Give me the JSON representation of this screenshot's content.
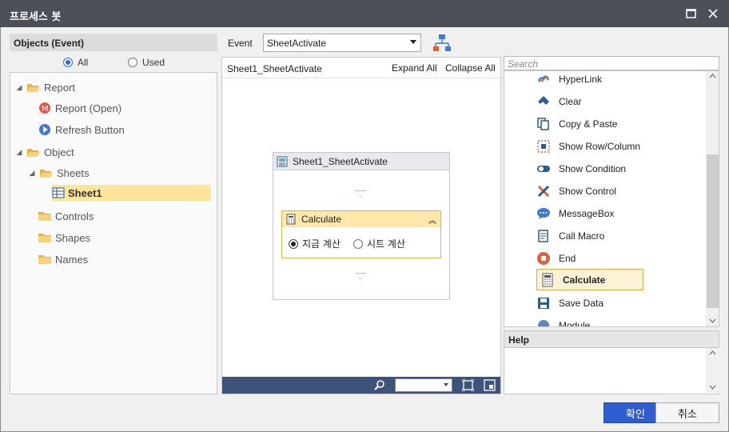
{
  "window": {
    "title": "프로세스 봇"
  },
  "left": {
    "header": "Objects (Event)",
    "filter": {
      "all": "All",
      "used": "Used",
      "selected": "all"
    },
    "tree": {
      "report": "Report",
      "report_open": "Report (Open)",
      "refresh_button": "Refresh Button",
      "object": "Object",
      "sheets": "Sheets",
      "sheet1": "Sheet1",
      "controls": "Controls",
      "shapes": "Shapes",
      "names": "Names"
    }
  },
  "event": {
    "label": "Event",
    "value": "SheetActivate"
  },
  "canvas": {
    "name": "Sheet1_SheetActivate",
    "expand_all": "Expand All",
    "collapse_all": "Collapse All",
    "event_box_title": "Sheet1_SheetActivate",
    "calc_card": {
      "title": "Calculate",
      "option1": "지금 계산",
      "option2": "시트 계산",
      "selected": "option1"
    }
  },
  "right": {
    "search_placeholder": "Search",
    "actions": [
      "HyperLink",
      "Clear",
      "Copy & Paste",
      "Show Row/Column",
      "Show Condition",
      "Show Control",
      "MessageBox",
      "Call Macro",
      "End",
      "Calculate",
      "Save Data",
      "Module"
    ],
    "selected_action": "Calculate",
    "help_title": "Help"
  },
  "buttons": {
    "ok": "확인",
    "cancel": "취소"
  },
  "colors": {
    "titlebar": "#4b4f57",
    "accent": "#2f5ed3",
    "selection": "#ffe59c",
    "canvas_footer": "#3d5379"
  }
}
